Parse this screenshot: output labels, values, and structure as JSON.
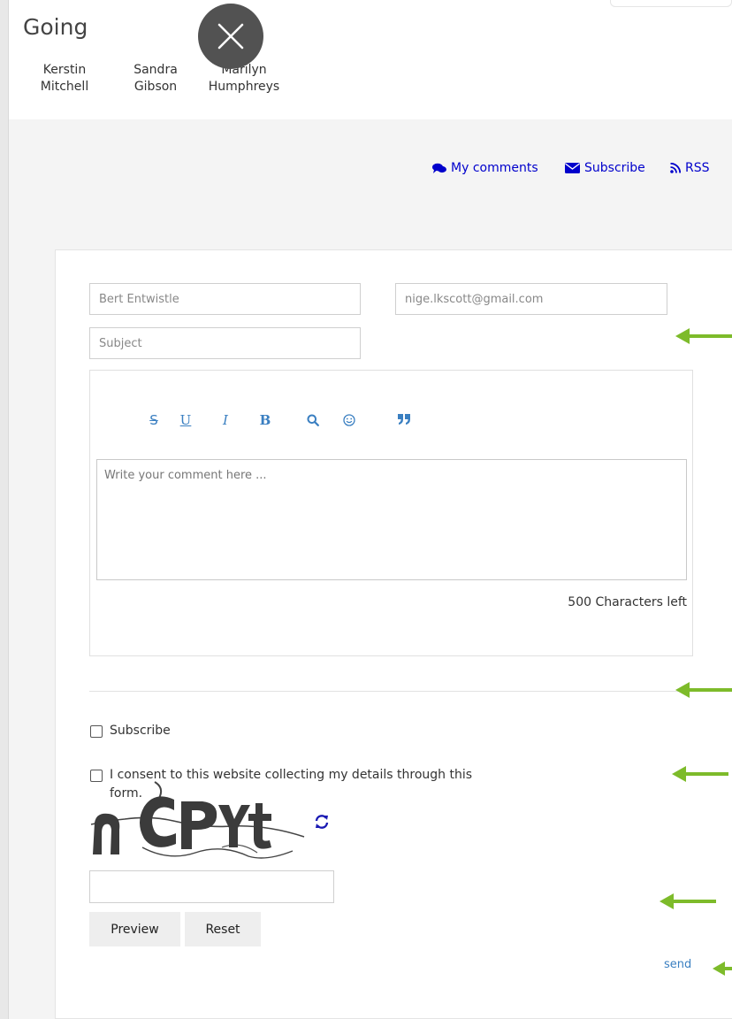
{
  "event": {
    "title": "Going",
    "attendees": [
      {
        "first": "Kerstin",
        "last": "Mitchell"
      },
      {
        "first": "Sandra",
        "last": "Gibson"
      },
      {
        "first": "Marilyn",
        "last": "Humphreys"
      }
    ]
  },
  "links": {
    "my_comments": "My comments",
    "subscribe": "Subscribe",
    "rss": "RSS"
  },
  "form": {
    "name_placeholder": "Bert Entwistle",
    "email_placeholder": "nige.lkscott@gmail.com",
    "subject_placeholder": "Subject",
    "comment_placeholder": "Write your comment here ...",
    "chars_left": "500 Characters left",
    "subscribe_label": "Subscribe",
    "consent_label_line1": "I consent to this website collecting my details through this",
    "consent_label_line2": "form.",
    "captcha_text": "nCPYt",
    "preview_button": "Preview",
    "reset_button": "Reset",
    "send_link": "send"
  },
  "toolbar": [
    {
      "name": "strikethrough",
      "glyph": "S"
    },
    {
      "name": "underline",
      "glyph": "U"
    },
    {
      "name": "italic",
      "glyph": "I"
    },
    {
      "name": "bold",
      "glyph": "B"
    },
    {
      "name": "search",
      "glyph": "search-icon"
    },
    {
      "name": "emoji",
      "glyph": "smiley-icon"
    },
    {
      "name": "quote",
      "glyph": "quote-icon"
    }
  ],
  "colors": {
    "link": "#0000cc",
    "toolbar": "#3a7fc1",
    "arrow": "#7dbb2a",
    "close_button": "#525252"
  }
}
